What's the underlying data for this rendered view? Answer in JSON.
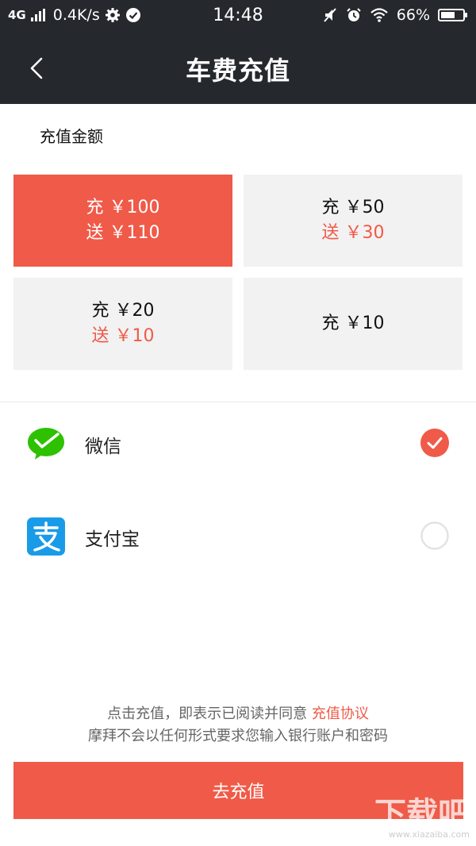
{
  "status_bar": {
    "network": "4G",
    "speed": "0.4K/s",
    "time": "14:48",
    "battery_percent": "66%",
    "battery_level": 0.66,
    "icons": [
      "signal-icon",
      "settings-icon",
      "check-circle-icon",
      "mute-icon",
      "alarm-icon",
      "wifi-icon",
      "battery-icon"
    ]
  },
  "navbar": {
    "title": "车费充值",
    "back_icon": "chevron-left-icon"
  },
  "amount_section": {
    "label": "充值金额",
    "options": [
      {
        "charge": "充 ￥100",
        "bonus": "送 ￥110",
        "selected": true
      },
      {
        "charge": "充 ￥50",
        "bonus": "送 ￥30",
        "selected": false
      },
      {
        "charge": "充 ￥20",
        "bonus": "送 ￥10",
        "selected": false
      },
      {
        "charge": "充 ￥10",
        "bonus": "",
        "selected": false
      }
    ]
  },
  "payment_methods": [
    {
      "name": "微信",
      "icon": "wechat-icon",
      "selected": true
    },
    {
      "name": "支付宝",
      "icon": "alipay-icon",
      "selected": false
    }
  ],
  "agreement": {
    "text_prefix": "点击充值，即表示已阅读并同意 ",
    "link": "充值协议",
    "notice": "摩拜不会以任何形式要求您输入银行账户和密码"
  },
  "submit": {
    "label": "去充值"
  },
  "watermark": {
    "text": "下载吧",
    "url": "www.xiazaiba.com"
  },
  "colors": {
    "accent": "#f05a48",
    "header_bg": "#25282d",
    "card_bg": "#f2f2f2",
    "wechat_green": "#2dc100",
    "alipay_blue": "#1a9be8"
  }
}
